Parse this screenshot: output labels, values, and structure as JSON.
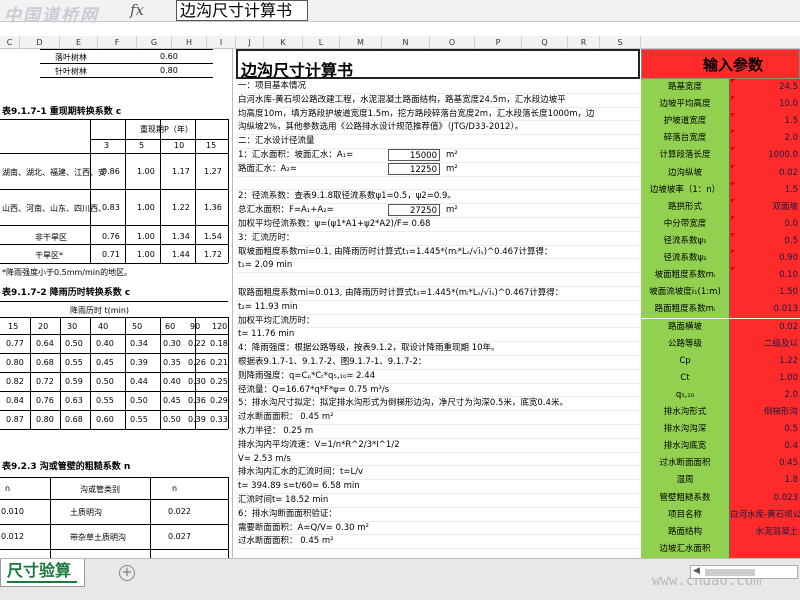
{
  "topbar": {
    "logo_text": "中国道桥网",
    "fx_label": "fx",
    "formula_value": "边沟尺寸计算书"
  },
  "columns": [
    "C",
    "D",
    "E",
    "F",
    "G",
    "H",
    "I",
    "J",
    "K",
    "L",
    "M",
    "N",
    "O",
    "P",
    "Q",
    "R",
    "S"
  ],
  "left": {
    "top_rows": [
      [
        "落叶树林",
        "0.60"
      ],
      [
        "针叶树林",
        "0.80"
      ]
    ],
    "table1_title": "表9.1.7-1  重现期转换系数 c",
    "table1_sub": "p",
    "table1_header": "重现期P（年）",
    "table1_cols": [
      "3",
      "5",
      "10",
      "15"
    ],
    "table1_rows": [
      {
        "label": "湖南、湖北、福建、江西、安",
        "vals": [
          "0.86",
          "1.00",
          "1.17",
          "1.27"
        ]
      },
      {
        "label": "山西、河南、山东、四川西、",
        "vals": [
          "0.83",
          "1.00",
          "1.22",
          "1.36"
        ]
      },
      {
        "label": "非干旱区",
        "vals": [
          "0.76",
          "1.00",
          "1.34",
          "1.54"
        ]
      },
      {
        "label": "干旱区*",
        "vals": [
          "0.71",
          "1.00",
          "1.44",
          "1.72"
        ]
      }
    ],
    "table1_note": "*降雨强度小于0.5mm/min的地区。",
    "table2_title": "表9.1.7-2  降雨历时转换系数 c",
    "table2_sub": "t",
    "table2_header": "降雨历时 t(min)",
    "table2_cols": [
      "15",
      "20",
      "30",
      "40",
      "50",
      "60",
      "90",
      "120"
    ],
    "table2_rows": [
      [
        "0.77",
        "0.64",
        "0.50",
        "0.40",
        "0.34",
        "0.30",
        "0.22",
        "0.18"
      ],
      [
        "0.80",
        "0.68",
        "0.55",
        "0.45",
        "0.39",
        "0.35",
        "0.26",
        "0.21"
      ],
      [
        "0.82",
        "0.72",
        "0.59",
        "0.50",
        "0.44",
        "0.40",
        "0.30",
        "0.25"
      ],
      [
        "0.84",
        "0.76",
        "0.63",
        "0.55",
        "0.50",
        "0.45",
        "0.36",
        "0.29"
      ],
      [
        "0.87",
        "0.80",
        "0.68",
        "0.60",
        "0.55",
        "0.50",
        "0.39",
        "0.33"
      ]
    ],
    "table3_title": "表9.2.3  沟或管壁的粗糙系数 n",
    "table3_cols": [
      "n",
      "沟或管类别",
      "n"
    ],
    "table3_rows": [
      [
        "0.010",
        "土质明沟",
        "0.022"
      ],
      [
        "0.012",
        "带杂草土质明沟",
        "0.027"
      ],
      [
        "0.013",
        "砂砾质明沟",
        ""
      ]
    ]
  },
  "mid": {
    "title": "边沟尺寸计算书",
    "lines": [
      {
        "t": "一：项目基本情况"
      },
      {
        "t": "    白河水库-黄石坝公路改建工程，水泥混凝土路面结构，路基宽度24.5m，汇水段边坡平"
      },
      {
        "t": "均高度10m，填方路段护坡道宽度1.5m，挖方路段碎落台宽度2m，汇水段落长度1000m，边"
      },
      {
        "t": "沟纵坡2%，其他参数选用《公路排水设计规范推荐值》（JTG/D33-2012）。"
      },
      {
        "t": "二：汇水设计径流量"
      },
      {
        "t": "1：汇水面积：坡面汇水：A₁=",
        "v": "15000",
        "u": "m²"
      },
      {
        "t": "             路面汇水：A₂=",
        "v": "12250",
        "u": "m²"
      },
      {
        "t": ""
      },
      {
        "t": "2：径流系数：查表9.1.8取径流系数ψ1=0.5，ψ2=0.9。"
      },
      {
        "t": "   总汇水面积：F=A₁+A₂=",
        "v": "27250",
        "u": "m²"
      },
      {
        "t": "   加权平均径流系数：ψ=(ψ1*A1+ψ2*A2)/F=     0.68"
      },
      {
        "t": "3：汇流历时："
      },
      {
        "t": "   取坡面粗度系数mi=0.1,      由降雨历时计算式t₁=1.445*(mᵢ*Lₛ/√iₛ)^0.467计算得："
      },
      {
        "t": "         t₁=       2.09   min"
      },
      {
        "t": ""
      },
      {
        "t": "   取路面粗度系数mi=0.013,    由降雨历时计算式t₁=1.445*(mᵢ*Lₛ/√iₛ)^0.467计算得："
      },
      {
        "t": "         t₂=      11.93   min"
      },
      {
        "t": "   加权平均汇流历时："
      },
      {
        "t": "         t=        11.76   min"
      },
      {
        "t": "4：降雨强度：根据公路等级，按表9.1.2，取设计降雨重现期   10年。"
      },
      {
        "t": "   根据表9.1.7-1、9.1.7-2、图9.1.7-1、9.1.7-2："
      },
      {
        "t": "   则降雨强度：q=Cₚ*Cₜ*q₅,₁₀=       2.44"
      },
      {
        "t": "   径流量：Q=16.67*q*F*ψ=         0.75   m³/s"
      },
      {
        "t": "5：排水沟尺寸拟定：拟定排水沟形式为倒梯形边沟，净尺寸为沟深0.5米，底宽0.4米。"
      },
      {
        "t": "   过水断面面积：        0.45   m²"
      },
      {
        "t": "   水力半径：            0.25   m"
      },
      {
        "t": "   排水沟内平均流速：V=1/n*R^2/3*I^1/2"
      },
      {
        "t": "                V=        2.53   m/s"
      },
      {
        "t": "   排水沟内汇水的汇流时间：t=L/v"
      },
      {
        "t": "         t=     394.89   s=t/60=     6.58   min"
      },
      {
        "t": "   汇流时间t=          18.52   min"
      },
      {
        "t": "6：排水沟断面面积验证："
      },
      {
        "t": "   需要断面面积：A=Q/V=           0.30   m²"
      },
      {
        "t": "   过水断面面积：                 0.45   m²"
      }
    ]
  },
  "right": {
    "title": "输入参数",
    "rows": [
      [
        "路基宽度",
        "24.5"
      ],
      [
        "边坡平均高度",
        "10.0"
      ],
      [
        "护坡道宽度",
        "1.5"
      ],
      [
        "碎落台宽度",
        "2.0"
      ],
      [
        "计算段落长度",
        "1000.0"
      ],
      [
        "边沟纵坡",
        "0.02"
      ],
      [
        "边坡坡率（1：n）",
        "1.5"
      ],
      [
        "路拱形式",
        "双面坡"
      ],
      [
        "中分带宽度",
        "0.0"
      ],
      [
        "径流系数ψ₁",
        "0.5"
      ],
      [
        "径流系数ψ₂",
        "0.90"
      ],
      [
        "坡面粗度系数mᵢ",
        "0.10"
      ],
      [
        "坡面流坡度i₁(1:m)",
        "1.50"
      ],
      [
        "路面粗度系数mᵢ",
        "0.013"
      ],
      [
        "路面横坡",
        "0.02"
      ],
      [
        "公路等级",
        "二级及以"
      ],
      [
        "Cp",
        "1.22"
      ],
      [
        "Ct",
        "1.00"
      ],
      [
        "q₅,₁₀",
        "2.0"
      ],
      [
        "排水沟形式",
        "倒梯形沟"
      ],
      [
        "排水沟沟深",
        "0.5"
      ],
      [
        "排水沟底宽",
        "0.4"
      ],
      [
        "过水断面面积",
        "0.45"
      ],
      [
        "湿周",
        "1.8"
      ],
      [
        "管壁粗糙系数",
        "0.023"
      ],
      [
        "项目名称",
        "白河水库-黄石坝公路"
      ],
      [
        "路面结构",
        "水泥混凝土"
      ],
      [
        "边坡汇水面积",
        ""
      ]
    ]
  },
  "tabs": {
    "sheet_name": "尺寸验算",
    "add_symbol": "+"
  },
  "watermark": "www.chdao.com"
}
